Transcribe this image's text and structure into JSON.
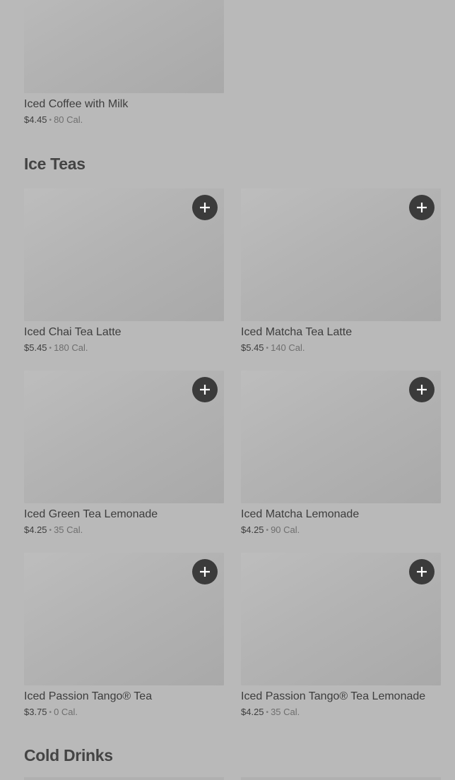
{
  "top_item": {
    "name": "Iced Coffee with Milk",
    "price": "$4.45",
    "sep": "•",
    "cal": "80 Cal."
  },
  "sections": [
    {
      "title": "Ice Teas",
      "items": [
        {
          "name": "Iced Chai Tea Latte",
          "price": "$5.45",
          "sep": "•",
          "cal": "180 Cal."
        },
        {
          "name": "Iced Matcha Tea Latte",
          "price": "$5.45",
          "sep": "•",
          "cal": "140 Cal."
        },
        {
          "name": "Iced Green Tea Lemonade",
          "price": "$4.25",
          "sep": "•",
          "cal": "35 Cal."
        },
        {
          "name": "Iced Matcha Lemonade",
          "price": "$4.25",
          "sep": "•",
          "cal": "90 Cal."
        },
        {
          "name": "Iced Passion Tango® Tea",
          "price": "$3.75",
          "sep": "•",
          "cal": "0 Cal."
        },
        {
          "name": "Iced Passion Tango® Tea Lemonade",
          "price": "$4.25",
          "sep": "•",
          "cal": "35 Cal."
        }
      ]
    },
    {
      "title": "Cold Drinks",
      "items": []
    }
  ],
  "icons": {
    "add": "plus-icon"
  }
}
